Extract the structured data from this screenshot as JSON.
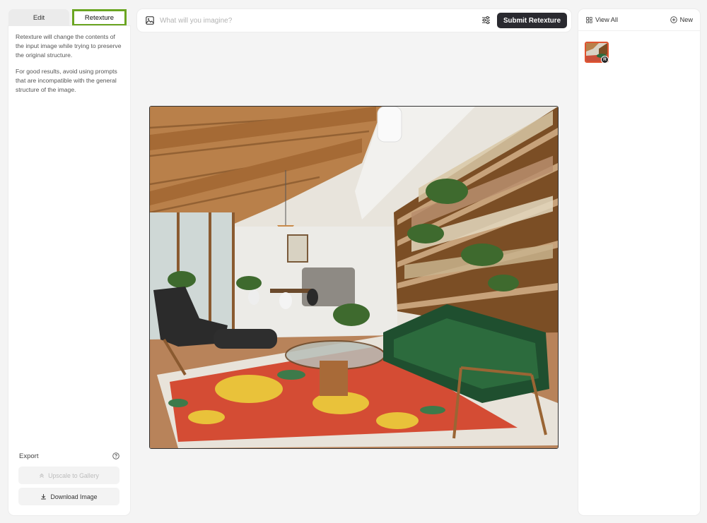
{
  "left_panel": {
    "tabs": [
      {
        "label": "Edit",
        "active": false
      },
      {
        "label": "Retexture",
        "active": true
      }
    ],
    "description": [
      "Retexture will change the contents of the input image while trying to preserve the original structure.",
      "For good results, avoid using prompts that are incompatible with the general structure of the image."
    ],
    "export": {
      "label": "Export",
      "help_icon": "question-circle-icon",
      "upscale_label": "Upscale to Gallery",
      "download_label": "Download Image"
    }
  },
  "top_bar": {
    "image_icon": "image-icon",
    "prompt_placeholder": "What will you imagine?",
    "prompt_value": "",
    "settings_icon": "sliders-icon",
    "submit_label": "Submit Retexture"
  },
  "right_panel": {
    "view_all_label": "View All",
    "new_label": "New",
    "thumb_badge": "R"
  },
  "colors": {
    "accent_tab_border": "#6aa521",
    "submit_bg": "#2a2a30",
    "thumb_border": "#e0532f"
  }
}
